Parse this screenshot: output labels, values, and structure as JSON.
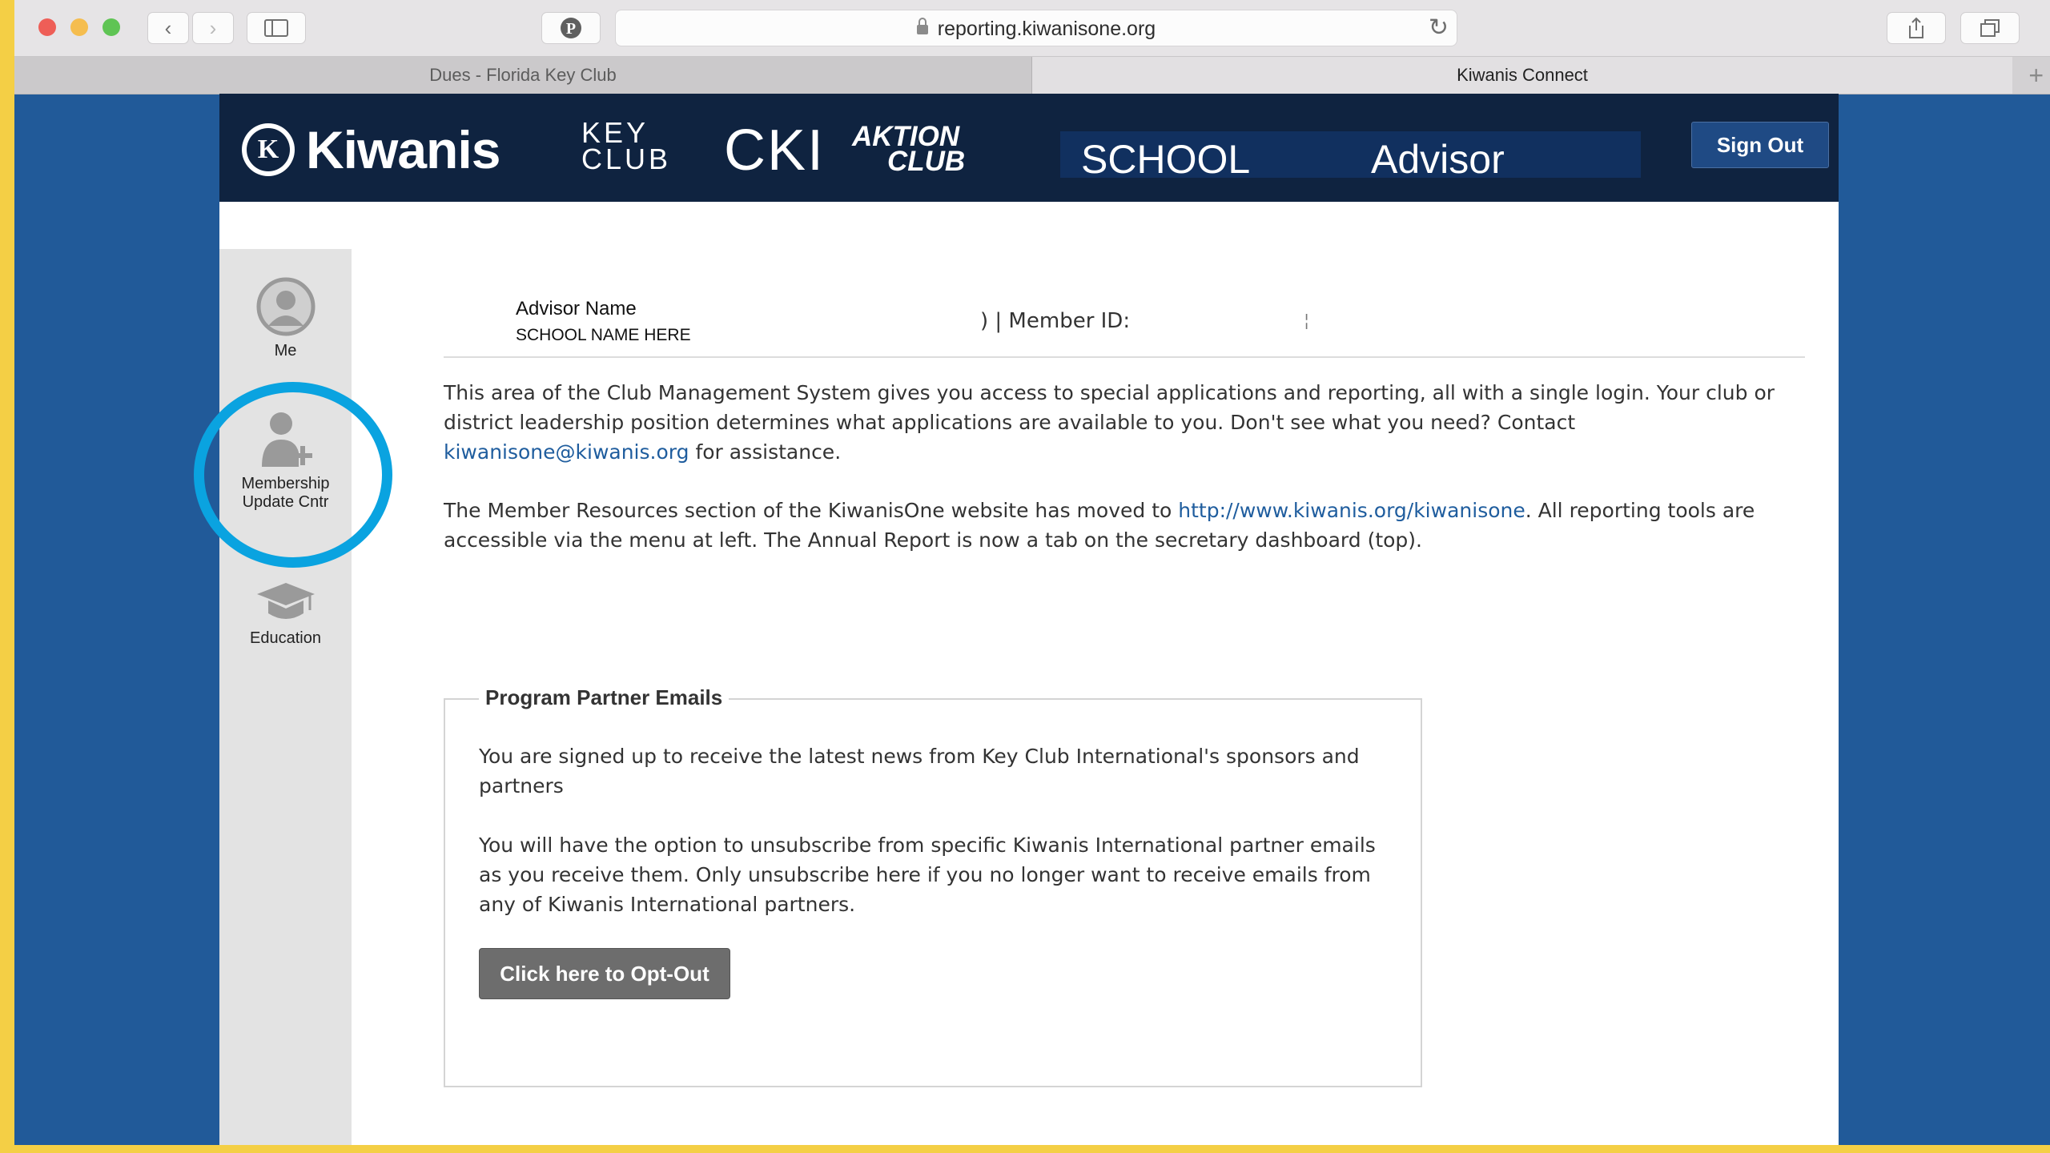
{
  "browser": {
    "url": "reporting.kiwanisone.org",
    "tabs": [
      {
        "label": "Dues - Florida Key Club"
      },
      {
        "label": "Kiwanis Connect"
      }
    ]
  },
  "header": {
    "logos": {
      "kiwanis": "Kiwanis",
      "kiwanis_seal": "K",
      "key_club_line1": "KEY",
      "key_club_line2": "CLUB",
      "cki": "CKI",
      "aktion_line1": "AKTION",
      "aktion_line2": "CLUB"
    },
    "role_school": "SCHOOL",
    "role_title": "Advisor",
    "sign_out": "Sign Out"
  },
  "sidebar": {
    "items": [
      {
        "label": "Me",
        "icon": "user-circle-icon"
      },
      {
        "label_line1": "Membership",
        "label_line2": "Update Cntr",
        "icon": "user-add-icon"
      },
      {
        "label": "Education",
        "icon": "graduation-cap-icon"
      }
    ],
    "highlight_color": "#0aa3e0"
  },
  "profile": {
    "advisor_name": "Advisor Name",
    "school_name": "SCHOOL NAME HERE",
    "member_id_label": ") | Member ID:"
  },
  "intro": {
    "p1_text": "This area of the Club Management System gives you access to special applications and reporting, all with a single login. Your club or district leadership position determines what applications are available to you. Don't see what you need? Contact",
    "p1_link": "kiwanisone@kiwanis.org",
    "p1_after": "for assistance.",
    "p2_text": "The Member Resources section of the KiwanisOne website has moved to",
    "p2_link": "http://www.kiwanis.org/kiwanisone",
    "p2_after": ". All reporting tools are accessible via the menu at left. The Annual Report is now a tab on the secretary dashboard (top)."
  },
  "partner": {
    "title": "Program Partner Emails",
    "text1": "You are signed up to receive the latest news from Key Club International's sponsors and partners",
    "text2": "You will have the option to unsubscribe from specific Kiwanis International partner emails as you receive them. Only unsubscribe here if you no longer want to receive emails from any of Kiwanis International partners.",
    "button": "Click here to Opt-Out"
  },
  "colors": {
    "header_bg": "#0f2340",
    "page_bg": "#215a99",
    "link": "#1f5d9e",
    "frame_border": "#f4cf45"
  }
}
